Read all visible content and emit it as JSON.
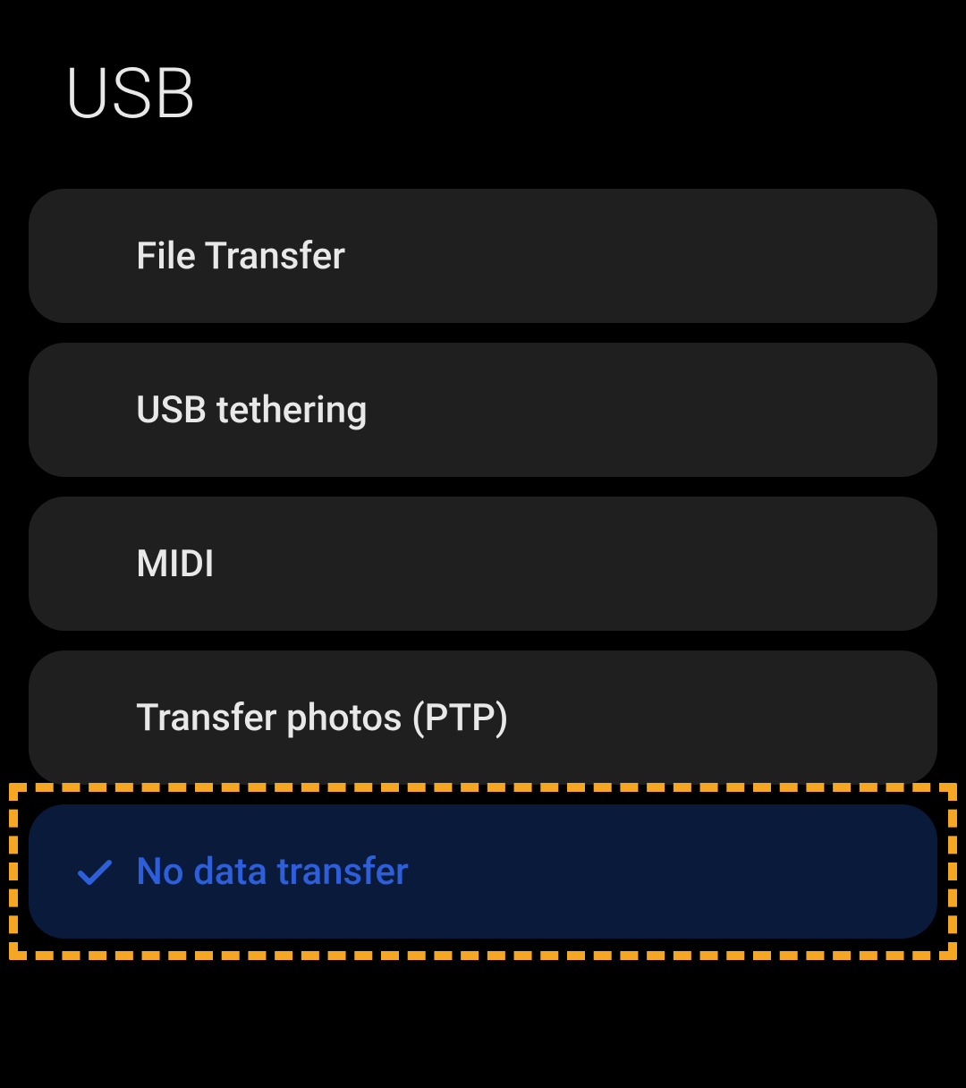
{
  "header": {
    "title": "USB"
  },
  "options": [
    {
      "label": "File Transfer",
      "selected": false
    },
    {
      "label": "USB tethering",
      "selected": false
    },
    {
      "label": "MIDI",
      "selected": false
    },
    {
      "label": "Transfer photos (PTP)",
      "selected": false
    },
    {
      "label": "No data transfer",
      "selected": true,
      "highlighted": true
    }
  ]
}
